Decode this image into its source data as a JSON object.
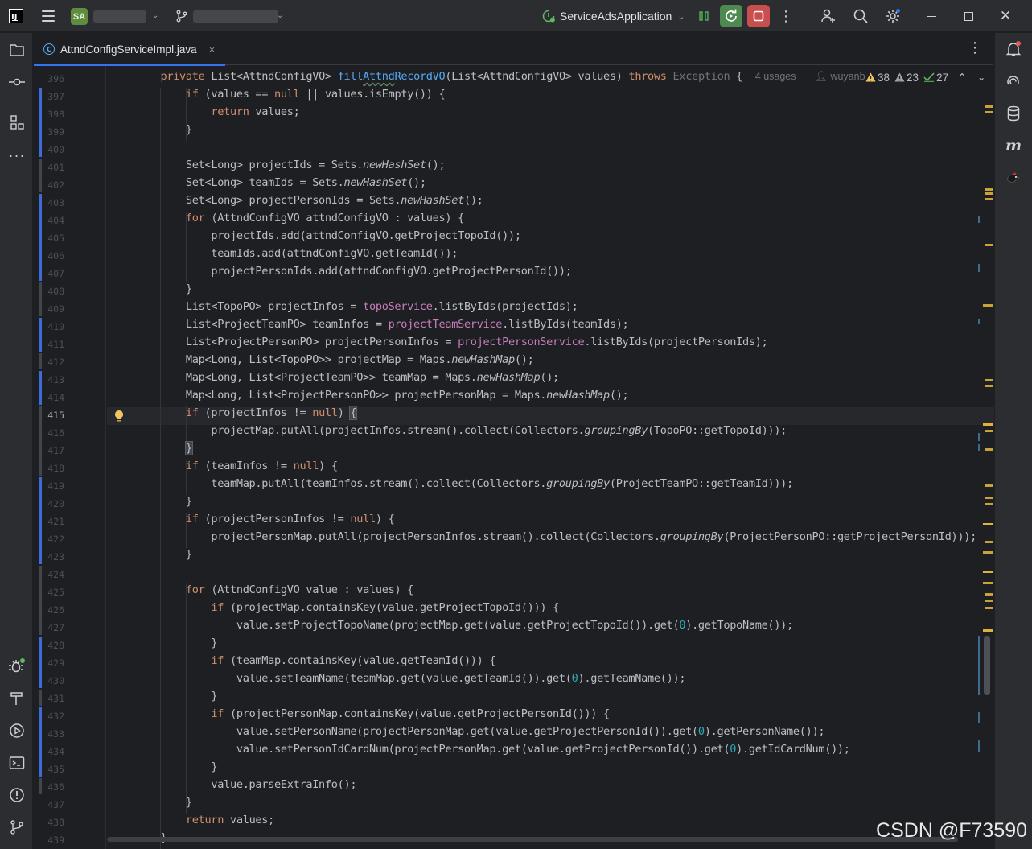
{
  "titlebar": {
    "project_badge": "SA",
    "run_config": "ServiceAdsApplication"
  },
  "tabs": [
    {
      "label": "AttndConfigServiceImpl.java",
      "icon": "class-c-icon",
      "close": "×"
    }
  ],
  "editor": {
    "current_line": 415,
    "hints": {
      "usages": "4 usages",
      "author": "wuyanbin *"
    },
    "problems": {
      "warnings": "38",
      "weak_warnings": "23",
      "typos": "27"
    },
    "line_numbers": [
      "396",
      "397",
      "398",
      "399",
      "400",
      "401",
      "402",
      "403",
      "404",
      "405",
      "406",
      "407",
      "408",
      "409",
      "410",
      "411",
      "412",
      "413",
      "414",
      "415",
      "416",
      "417",
      "418",
      "419",
      "420",
      "421",
      "422",
      "423",
      "424",
      "425",
      "426",
      "427",
      "428",
      "429",
      "430",
      "431",
      "432",
      "433",
      "434",
      "435",
      "436",
      "437",
      "438",
      "439"
    ],
    "lines": [
      "    private List<AttndConfigVO> fillAttndRecordVO(List<AttndConfigVO> values) throws Exception {",
      "        if (values == null || values.isEmpty()) {",
      "            return values;",
      "        }",
      "",
      "        Set<Long> projectIds = Sets.newHashSet();",
      "        Set<Long> teamIds = Sets.newHashSet();",
      "        Set<Long> projectPersonIds = Sets.newHashSet();",
      "        for (AttndConfigVO attndConfigVO : values) {",
      "            projectIds.add(attndConfigVO.getProjectTopoId());",
      "            teamIds.add(attndConfigVO.getTeamId());",
      "            projectPersonIds.add(attndConfigVO.getProjectPersonId());",
      "        }",
      "        List<TopoPO> projectInfos = topoService.listByIds(projectIds);",
      "        List<ProjectTeamPO> teamInfos = projectTeamService.listByIds(teamIds);",
      "        List<ProjectPersonPO> projectPersonInfos = projectPersonService.listByIds(projectPersonIds);",
      "        Map<Long, List<TopoPO>> projectMap = Maps.newHashMap();",
      "        Map<Long, List<ProjectTeamPO>> teamMap = Maps.newHashMap();",
      "        Map<Long, List<ProjectPersonPO>> projectPersonMap = Maps.newHashMap();",
      "        if (projectInfos != null) {",
      "            projectMap.putAll(projectInfos.stream().collect(Collectors.groupingBy(TopoPO::getTopoId)));",
      "        }",
      "        if (teamInfos != null) {",
      "            teamMap.putAll(teamInfos.stream().collect(Collectors.groupingBy(ProjectTeamPO::getTeamId)));",
      "        }",
      "        if (projectPersonInfos != null) {",
      "            projectPersonMap.putAll(projectPersonInfos.stream().collect(Collectors.groupingBy(ProjectPersonPO::getProjectPersonId)));",
      "        }",
      "",
      "        for (AttndConfigVO value : values) {",
      "            if (projectMap.containsKey(value.getProjectTopoId())) {",
      "                value.setProjectTopoName(projectMap.get(value.getProjectTopoId()).get(0).getTopoName());",
      "            }",
      "            if (teamMap.containsKey(value.getTeamId())) {",
      "                value.setTeamName(teamMap.get(value.getTeamId()).get(0).getTeamName());",
      "            }",
      "            if (projectPersonMap.containsKey(value.getProjectPersonId())) {",
      "                value.setPersonName(projectPersonMap.get(value.getProjectPersonId()).get(0).getPersonName());",
      "                value.setPersonIdCardNum(projectPersonMap.get(value.getProjectPersonId()).get(0).getIdCardNum());",
      "            }",
      "            value.parseExtraInfo();",
      "        }",
      "        return values;",
      "    }"
    ]
  },
  "watermark": "CSDN @F73590",
  "colors": {
    "keyword": "#cf8e6d",
    "method_decl": "#56a8f5",
    "field": "#c77dbb",
    "number": "#2aacb8",
    "accent": "#3574f0",
    "vcs_modified": "#3d6cd6"
  }
}
